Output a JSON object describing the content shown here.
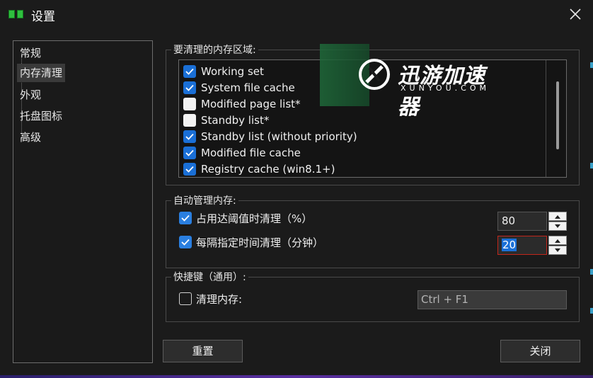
{
  "window": {
    "title": "设置"
  },
  "nav": {
    "items": [
      {
        "label": "常规",
        "selected": false
      },
      {
        "label": "内存清理",
        "selected": true
      },
      {
        "label": "外观",
        "selected": false
      },
      {
        "label": "托盘图标",
        "selected": false
      },
      {
        "label": "高级",
        "selected": false
      }
    ]
  },
  "memory_areas": {
    "title": "要清理的内存区域:",
    "items": [
      {
        "label": "Working set",
        "checked": true
      },
      {
        "label": "System file cache",
        "checked": true
      },
      {
        "label": "Modified page list*",
        "checked": false
      },
      {
        "label": "Standby list*",
        "checked": false
      },
      {
        "label": "Standby list (without priority)",
        "checked": true
      },
      {
        "label": "Modified file cache",
        "checked": true
      },
      {
        "label": "Registry cache (win8.1+)",
        "checked": true
      }
    ]
  },
  "watermark": {
    "text": "迅游加速器",
    "sub": "XUNYOU.COM"
  },
  "auto_manage": {
    "title": "自动管理内存:",
    "threshold": {
      "label": "占用达阈值时清理（%）",
      "checked": true,
      "value": "80"
    },
    "interval": {
      "label": "每隔指定时间清理（分钟）",
      "checked": true,
      "value": "20"
    }
  },
  "hotkey": {
    "title": "快捷键（通用）:",
    "clean": {
      "label": "清理内存:",
      "checked": false,
      "value": "Ctrl + F1"
    }
  },
  "buttons": {
    "reset": "重置",
    "close": "关闭"
  },
  "colors": {
    "accent": "#1a6fd6",
    "focus_border": "#c2261b"
  }
}
